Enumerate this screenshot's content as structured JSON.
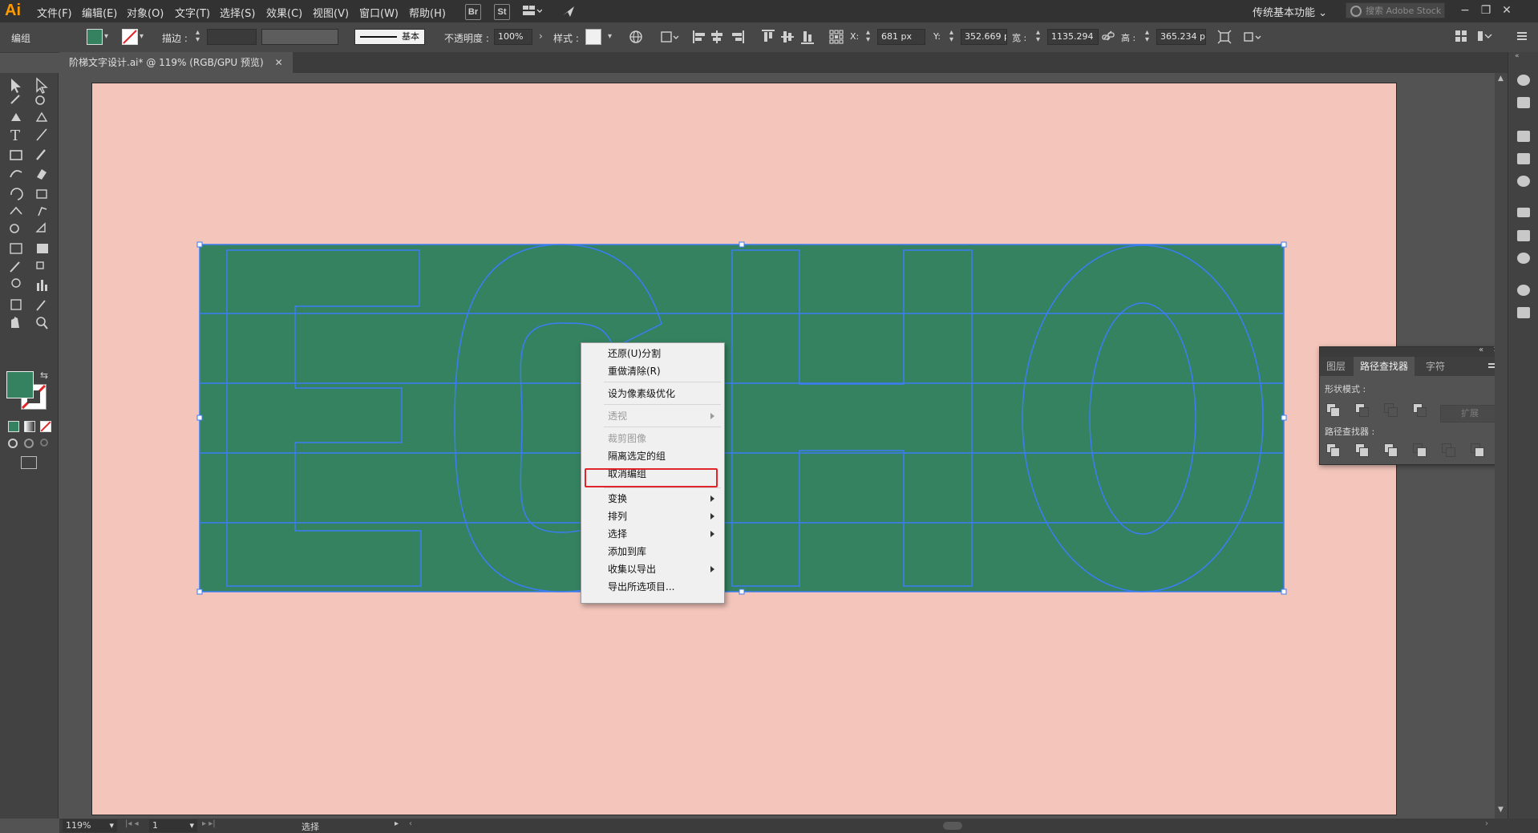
{
  "app": {
    "logo": "Ai"
  },
  "menu": [
    "文件(F)",
    "编辑(E)",
    "对象(O)",
    "文字(T)",
    "选择(S)",
    "效果(C)",
    "视图(V)",
    "窗口(W)",
    "帮助(H)"
  ],
  "app_buttons": {
    "bridge": "Br",
    "stock": "St"
  },
  "workspace": "传统基本功能",
  "stock_search": {
    "placeholder": "搜索 Adobe Stock"
  },
  "control_bar": {
    "selection_label": "编组",
    "stroke_label": "描边 :",
    "stroke_profile": "基本",
    "opacity_label": "不透明度 :",
    "opacity_value": "100%",
    "style_label": "样式 :",
    "x_label": "X:",
    "x_value": "681 px",
    "y_label": "Y:",
    "y_value": "352.669 p",
    "w_label": "宽 :",
    "w_value": "1135.294",
    "h_label": "高 :",
    "h_value": "365.234 p"
  },
  "document_tab": {
    "title": "阶梯文字设计.ai* @ 119% (RGB/GPU 预览)"
  },
  "artwork": {
    "text": "ECHO",
    "fill_color": "#348260",
    "outline_color": "#3b7df5",
    "artboard_color": "#f3c5bb"
  },
  "context_menu": {
    "items": [
      {
        "label": "还原(U)分割",
        "enabled": true,
        "submenu": false
      },
      {
        "label": "重做清除(R)",
        "enabled": true,
        "submenu": false
      },
      {
        "label": "设为像素级优化",
        "enabled": true,
        "submenu": false
      },
      {
        "label": "透视",
        "enabled": false,
        "submenu": true
      },
      {
        "label": "裁剪图像",
        "enabled": false,
        "submenu": false
      },
      {
        "label": "隔离选定的组",
        "enabled": true,
        "submenu": false
      },
      {
        "label": "取消编组",
        "enabled": true,
        "submenu": false,
        "highlighted": true
      },
      {
        "label": "变换",
        "enabled": true,
        "submenu": true
      },
      {
        "label": "排列",
        "enabled": true,
        "submenu": true
      },
      {
        "label": "选择",
        "enabled": true,
        "submenu": true
      },
      {
        "label": "添加到库",
        "enabled": true,
        "submenu": false
      },
      {
        "label": "收集以导出",
        "enabled": true,
        "submenu": true
      },
      {
        "label": "导出所选项目...",
        "enabled": true,
        "submenu": false
      }
    ],
    "highlight_color": "#e0262a"
  },
  "pathfinder_panel": {
    "tabs": [
      "图层",
      "路径查找器",
      "字符"
    ],
    "active_tab": "路径查找器",
    "shape_modes_label": "形状模式 :",
    "expand_label": "扩展",
    "pathfinders_label": "路径查找器 :"
  },
  "status_bar": {
    "zoom": "119%",
    "artboard_number": "1",
    "tool_status": "选择"
  }
}
